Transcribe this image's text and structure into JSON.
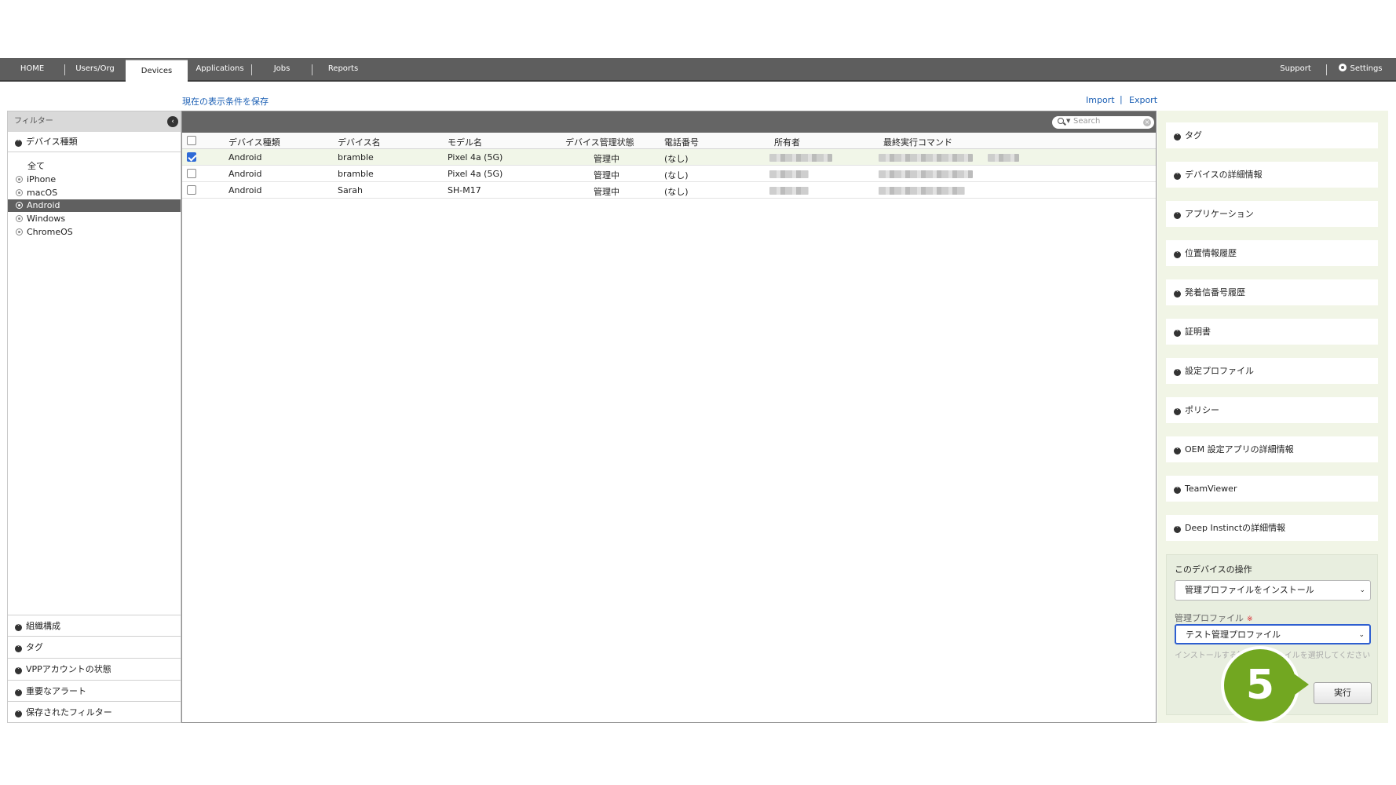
{
  "nav": {
    "tabs": [
      {
        "label": "HOME"
      },
      {
        "label": "Users/Org"
      },
      {
        "label": "Devices"
      },
      {
        "label": "Applications"
      },
      {
        "label": "Jobs"
      },
      {
        "label": "Reports"
      }
    ],
    "active_tab": "Devices",
    "support": "Support",
    "settings": "Settings"
  },
  "toolbar": {
    "save_view": "現在の表示条件を保存",
    "import": "Import",
    "separator": "|",
    "export": "Export"
  },
  "filter": {
    "title": "フィルター",
    "device_type_section": "デバイス種類",
    "items": [
      {
        "label": "全て"
      },
      {
        "label": "iPhone"
      },
      {
        "label": "macOS"
      },
      {
        "label": "Android",
        "selected": true
      },
      {
        "label": "Windows"
      },
      {
        "label": "ChromeOS"
      }
    ],
    "bottom_sections": [
      {
        "label": "組織構成"
      },
      {
        "label": "タグ"
      },
      {
        "label": "VPPアカウントの状態"
      },
      {
        "label": "重要なアラート"
      },
      {
        "label": "保存されたフィルター"
      }
    ]
  },
  "table": {
    "search_placeholder": "Search",
    "columns": [
      "デバイス種類",
      "デバイス名",
      "モデル名",
      "デバイス管理状態",
      "電話番号",
      "所有者",
      "最終実行コマンド"
    ],
    "rows": [
      {
        "type": "Android",
        "name": "bramble",
        "model": "Pixel 4a (5G)",
        "status": "管理中",
        "phone": "(なし)",
        "checked": true
      },
      {
        "type": "Android",
        "name": "bramble",
        "model": "Pixel 4a (5G)",
        "status": "管理中",
        "phone": "(なし)",
        "checked": false
      },
      {
        "type": "Android",
        "name": "Sarah",
        "model": "SH-M17",
        "status": "管理中",
        "phone": "(なし)",
        "checked": false
      }
    ]
  },
  "details": {
    "sections": [
      {
        "label": "タグ"
      },
      {
        "label": "デバイスの詳細情報"
      },
      {
        "label": "アプリケーション"
      },
      {
        "label": "位置情報履歴"
      },
      {
        "label": "発着信番号履歴"
      },
      {
        "label": "証明書"
      },
      {
        "label": "設定プロファイル"
      },
      {
        "label": "ポリシー"
      },
      {
        "label": "OEM 設定アプリの詳細情報"
      },
      {
        "label": "TeamViewer"
      },
      {
        "label": "Deep Instinctの詳細情報"
      }
    ]
  },
  "operation": {
    "title": "このデバイスの操作",
    "action_value": "管理プロファイルをインストール",
    "profile_label": "管理プロファイル",
    "required_mark": "※",
    "profile_value": "テスト管理プロファイル",
    "help_text": "インストールする管理プロファイルを選択してください",
    "execute": "実行"
  },
  "annotation": {
    "step_number": "5",
    "color": "#72a721"
  }
}
